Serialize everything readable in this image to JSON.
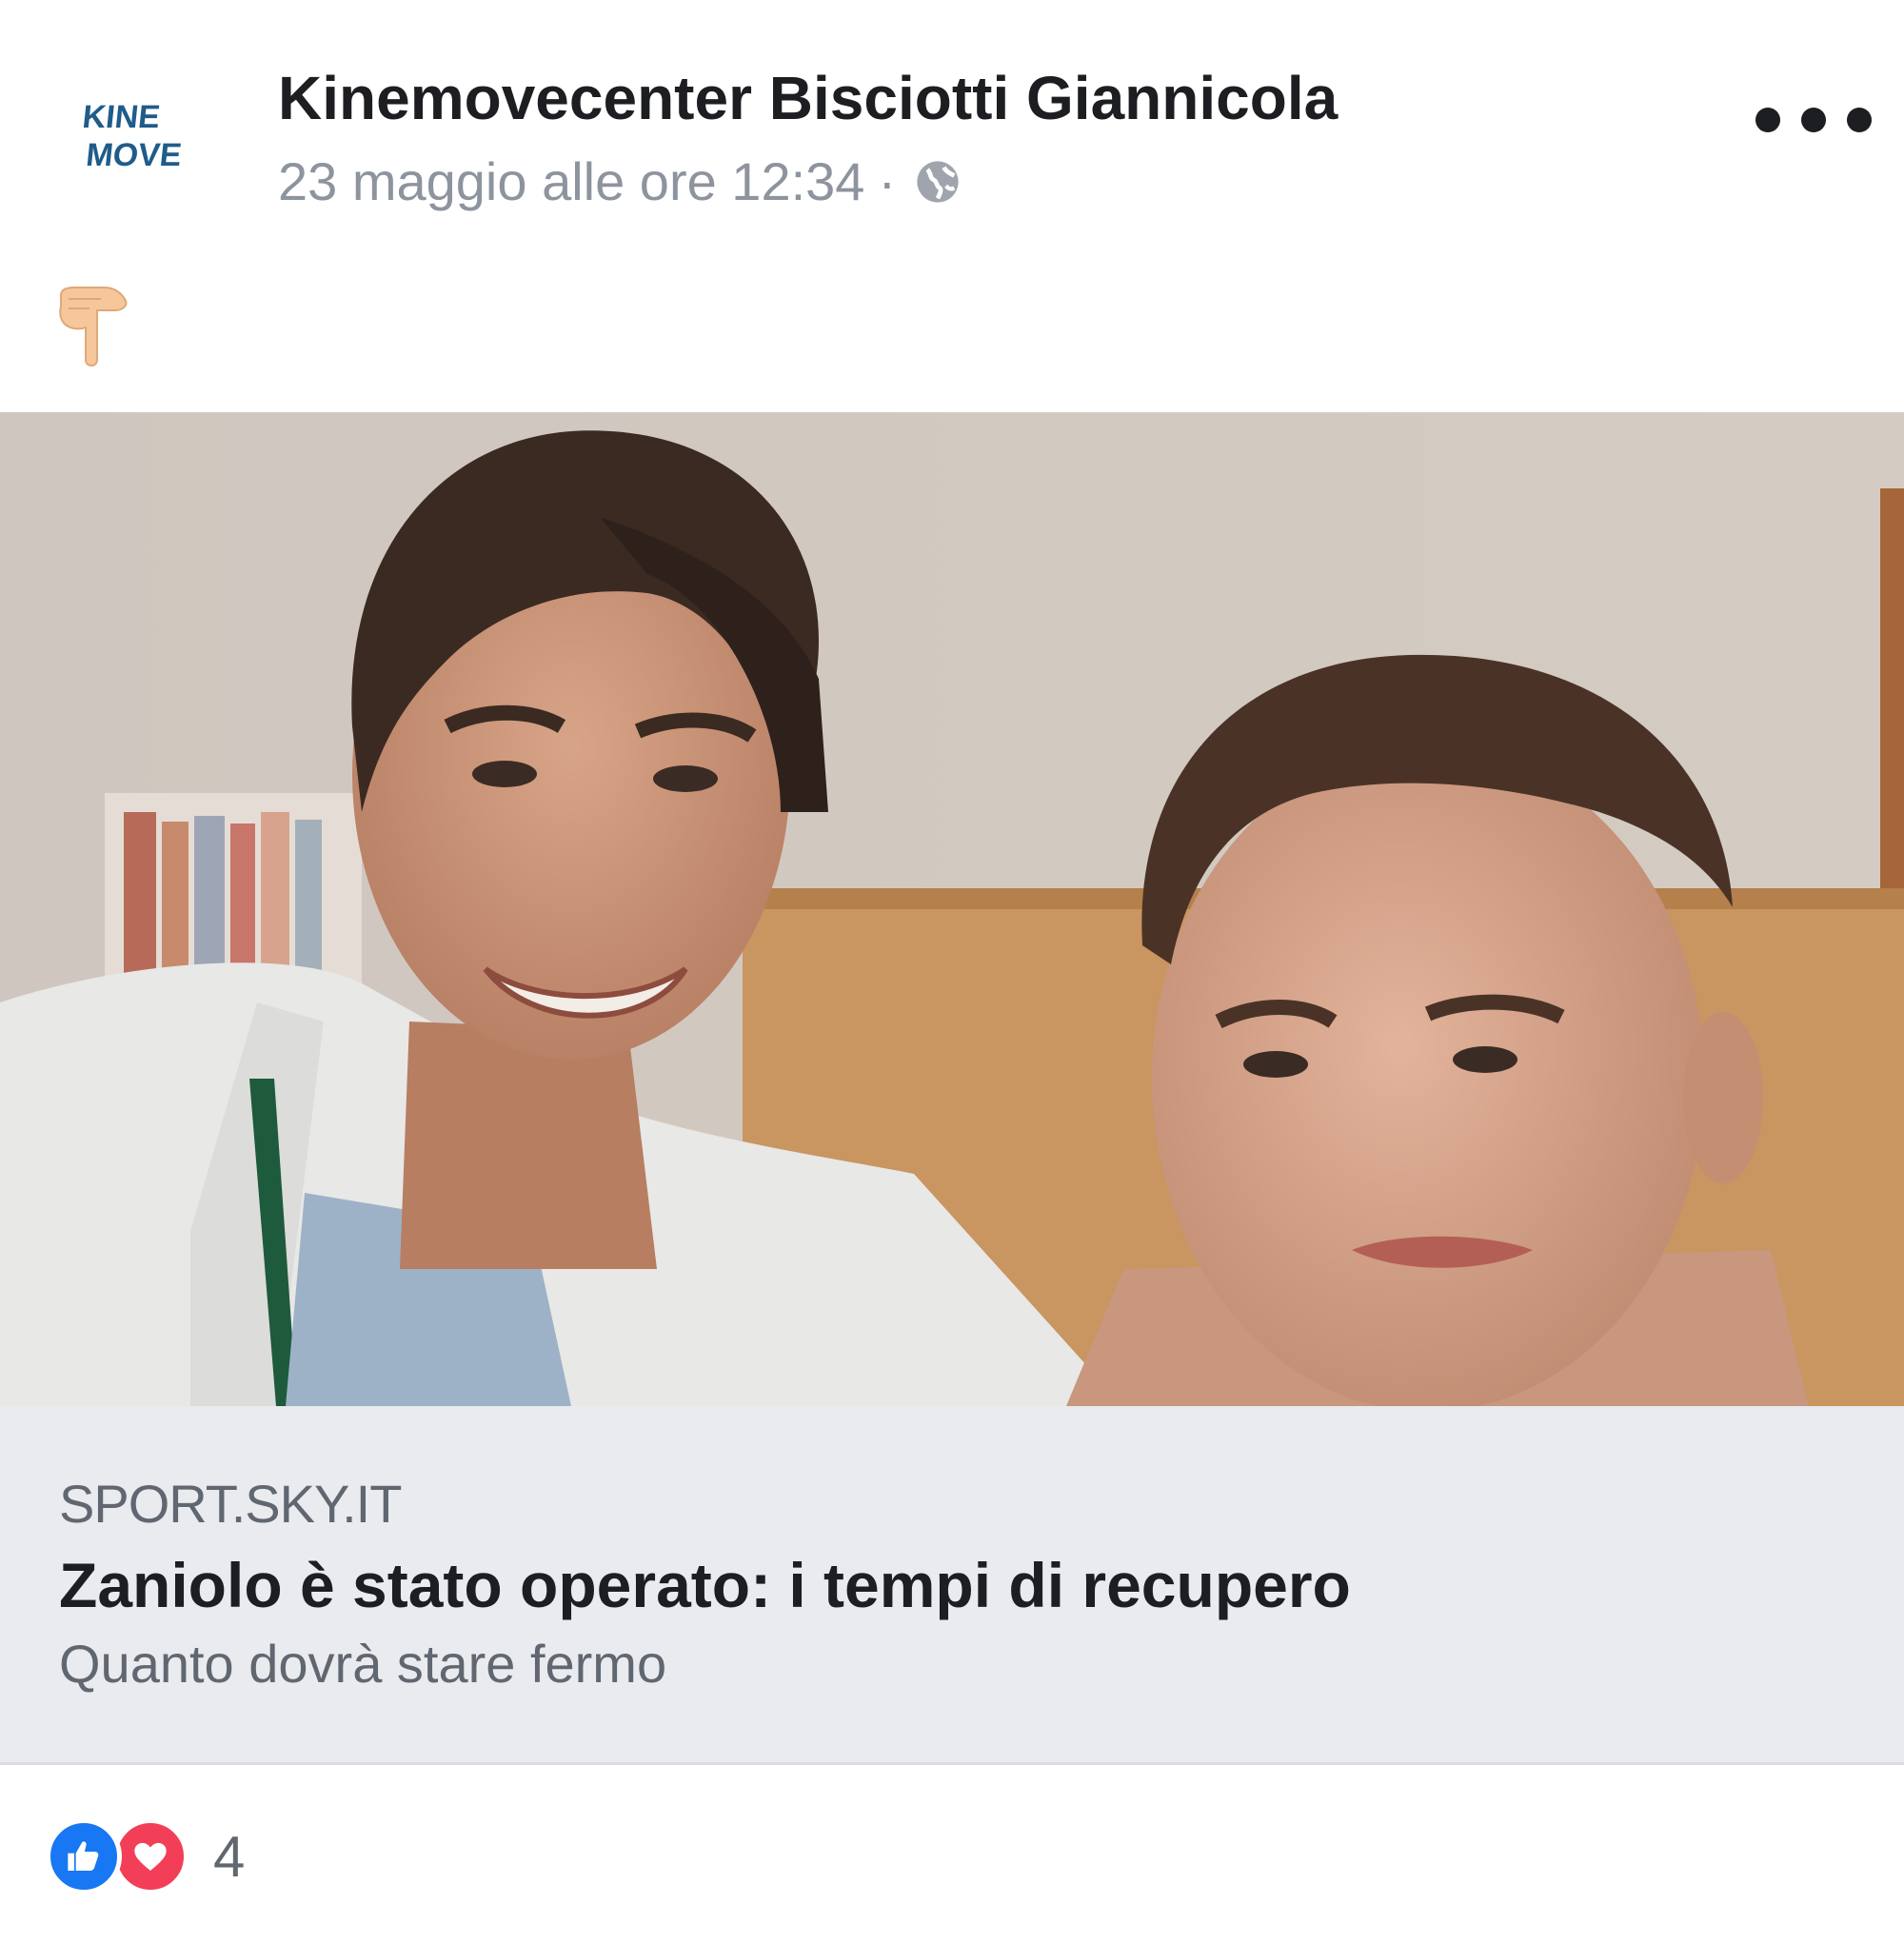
{
  "post": {
    "author": "Kinemovecenter Bisciotti Giannicola",
    "timestamp": "23 maggio alle ore 12:34",
    "separator": "·",
    "privacy_icon": "globe-icon",
    "avatar": {
      "logo_text": [
        "KINE",
        "MOVE"
      ],
      "color": "#1f5c8a"
    },
    "body_emoji": "👇",
    "more_icon": "more-horizontal-icon"
  },
  "link": {
    "domain": "SPORT.SKY.IT",
    "headline": "Zaniolo è stato operato: i tempi di recupero",
    "description": "Quanto dovrà stare fermo"
  },
  "reactions": {
    "icons": [
      "like-icon",
      "love-icon"
    ],
    "count": "4"
  },
  "colors": {
    "like": "#1877f2",
    "love": "#f33e58",
    "link_bg": "#e9ebee",
    "meta_text": "#8d949e"
  }
}
